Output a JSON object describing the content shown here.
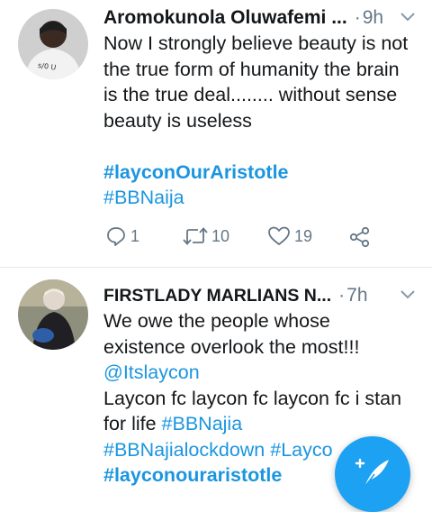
{
  "tweets": [
    {
      "author": "Aromokunola Oluwafemi ...",
      "separator": "·",
      "time": "9h",
      "lines": [
        "Now I strongly believe beauty is not",
        "the true form of humanity the brain",
        "is the true deal........ without sense",
        "beauty is useless"
      ],
      "hashtags": [
        "#layconOurAristotle",
        "#BBNaija"
      ],
      "replies": "1",
      "retweets": "10",
      "likes": "19"
    },
    {
      "author": "FIRSTLADY MARLIANS N...",
      "separator": "·",
      "time": "7h",
      "line1": "We owe the people whose",
      "line2": "existence overlook the most!!!",
      "mention": "@Itslaycon",
      "line4": "Laycon fc laycon fc laycon fc  i stan",
      "line5_text": "for life ",
      "line5_tag": "#BBNajia",
      "line6_tag1": "#BBNajialockdown",
      "line6_tag2": "#Layco",
      "line7_tag": "#layconouraristotle"
    }
  ],
  "icons": {
    "reply": "reply-icon",
    "retweet": "retweet-icon",
    "like": "heart-icon",
    "share": "share-icon",
    "menu": "chevron-down-icon",
    "compose": "compose-tweet-icon"
  },
  "colors": {
    "link": "#1b95e0",
    "muted": "#657786",
    "fab": "#1da1f2"
  }
}
